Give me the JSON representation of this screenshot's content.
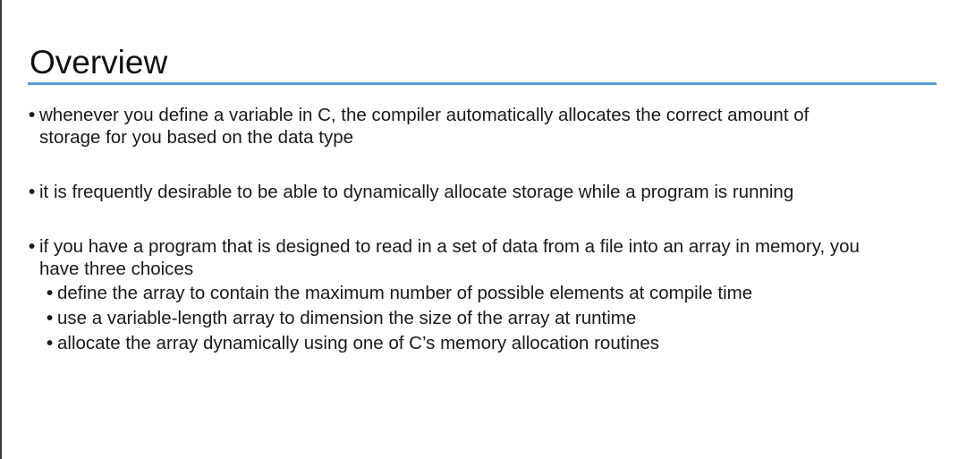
{
  "slide": {
    "title": "Overview",
    "bullet_symbol": "•",
    "bullets": [
      {
        "line1": "whenever you define a variable in C, the compiler automatically allocates the correct amount of",
        "line2": "storage for you based on the data type"
      },
      {
        "line1": "it is frequently desirable to be able to dynamically allocate storage while a program is running"
      },
      {
        "line1": "if you have a program that is designed to read in a set of data from a file into an array in memory, you",
        "line2": "have three choices"
      }
    ],
    "sub_bullets": [
      "define the array to contain the maximum number of possible elements at compile time",
      "use a variable-length array to dimension the size of the array at runtime",
      "allocate the array dynamically using one of C’s memory allocation routines"
    ],
    "colors": {
      "title_rule": "#5b9bd5",
      "text": "#1a1a1a"
    }
  }
}
